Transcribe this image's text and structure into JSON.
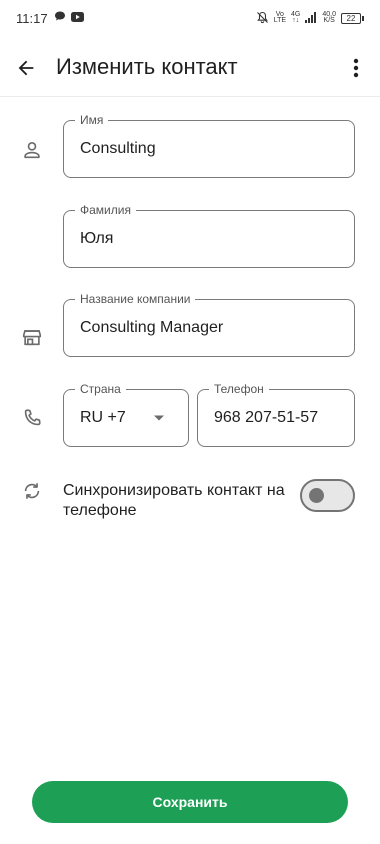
{
  "status_bar": {
    "time": "11:17",
    "volte_top": "Vo",
    "volte_bottom": "LTE",
    "network_type": "4G",
    "speed_value": "40,0",
    "speed_unit": "K/S",
    "battery_level": "22"
  },
  "app_bar": {
    "title": "Изменить контакт"
  },
  "form": {
    "first_name": {
      "label": "Имя",
      "value": "Consulting"
    },
    "last_name": {
      "label": "Фамилия",
      "value": "Юля"
    },
    "company": {
      "label": "Название компании",
      "value": "Consulting Manager"
    },
    "country": {
      "label": "Страна",
      "value": "RU +7"
    },
    "phone": {
      "label": "Телефон",
      "value": "968 207-51-57"
    },
    "sync": {
      "label": "Синхронизировать контакт на телефоне",
      "enabled": false
    }
  },
  "actions": {
    "save_label": "Сохранить"
  },
  "colors": {
    "accent": "#1e9f56",
    "outline": "#7a7a7a",
    "icon": "#6b6b6b"
  }
}
